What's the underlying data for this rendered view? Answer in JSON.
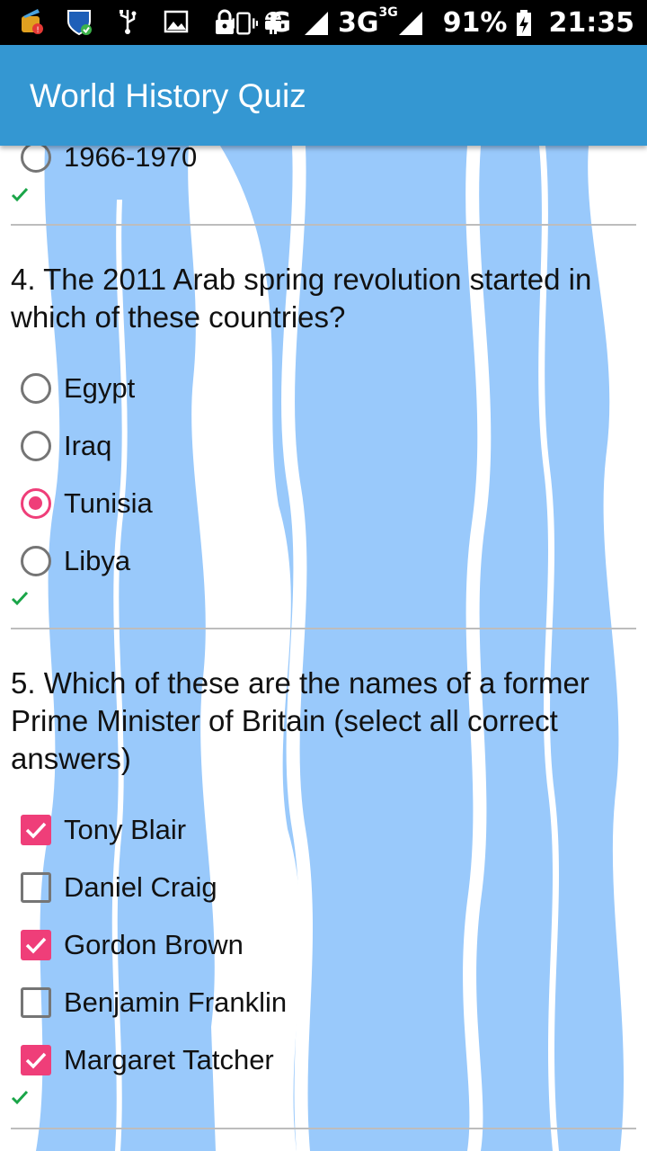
{
  "status_bar": {
    "network": "G",
    "network2": "3G",
    "network2_sup": "3G",
    "battery": "91%",
    "time": "21:35",
    "icons": [
      "cleaner-icon",
      "shield-icon",
      "usb-icon",
      "image-icon",
      "lock-icon",
      "android-icon",
      "vibrate-icon",
      "signal-icon",
      "battery-charging-icon"
    ]
  },
  "app_bar": {
    "title": "World History Quiz"
  },
  "partial_option": {
    "label": "1966-1970",
    "selected": false
  },
  "question4": {
    "text": "4. The 2011 Arab spring revolution started in which of these countries?",
    "options": [
      {
        "label": "Egypt",
        "selected": false
      },
      {
        "label": "Iraq",
        "selected": false
      },
      {
        "label": "Tunisia",
        "selected": true
      },
      {
        "label": "Libya",
        "selected": false
      }
    ]
  },
  "question5": {
    "text": "5. Which of these are the names of a former Prime Minister of Britain (select all correct answers)",
    "options": [
      {
        "label": "Tony Blair",
        "checked": true
      },
      {
        "label": "Daniel Craig",
        "checked": false
      },
      {
        "label": "Gordon Brown",
        "checked": true
      },
      {
        "label": "Benjamin Franklin",
        "checked": false
      },
      {
        "label": "Margaret Tatcher",
        "checked": true
      }
    ]
  },
  "colors": {
    "app_bar": "#3497d2",
    "accent": "#ef3e79",
    "correct_tick": "#1aa548",
    "background_art": "#99c9fb"
  }
}
